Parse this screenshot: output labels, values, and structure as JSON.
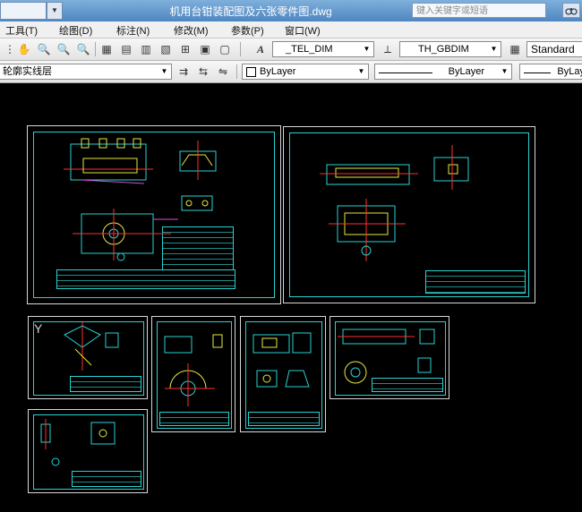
{
  "window": {
    "title": "机用台钳装配图及六张零件图.dwg",
    "search_placeholder": "键入关键字或短语"
  },
  "menu": {
    "items": [
      "工具(T)",
      "绘图(D)",
      "标注(N)",
      "修改(M)",
      "参数(P)",
      "窗口(W)"
    ]
  },
  "toolbar_styles": {
    "text_style": "_TEL_DIM",
    "dim_style": "TH_GBDIM",
    "table_style": "Standard"
  },
  "toolbar_layers": {
    "current_layer": "轮廓实线层",
    "color": "ByLayer",
    "linetype": "ByLayer",
    "lineweight": "ByLay"
  },
  "canvas": {
    "ucs_label": "Y",
    "background": "#000000",
    "frame_color": "#2ad2d2"
  }
}
